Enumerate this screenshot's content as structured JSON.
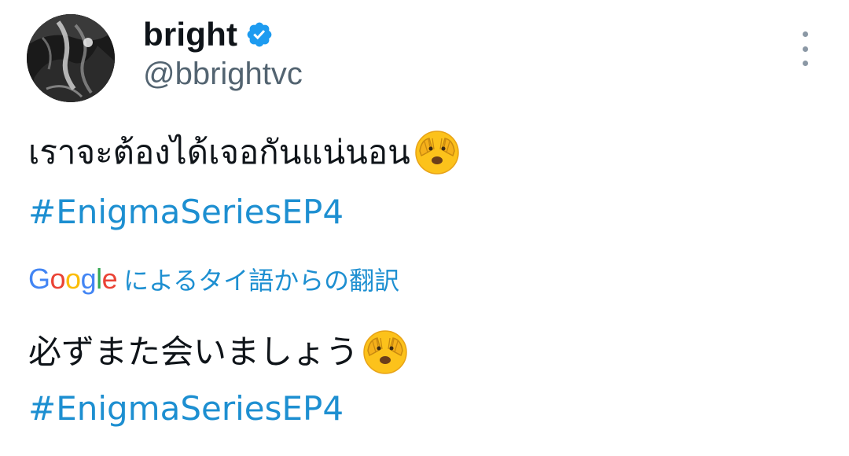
{
  "author": {
    "display_name": "bright",
    "handle": "@bbrightvc",
    "verified": true,
    "avatar_icon": "profile-photo"
  },
  "tweet": {
    "text": "เราจะต้องได้เจอกันแน่นอน",
    "emoji": "🫣",
    "hashtag": "#EnigmaSeriesEP4"
  },
  "translation": {
    "provider_letters": [
      "G",
      "o",
      "o",
      "g",
      "l",
      "e"
    ],
    "label": "によるタイ語からの翻訳",
    "text": "必ずまた会いましょう",
    "hashtag": "#EnigmaSeriesEP4"
  },
  "colors": {
    "link": "#1d8fd1",
    "verified": "#1d9bf0",
    "handle": "#536471",
    "text": "#0f1419"
  },
  "icons": {
    "verified": "verified-badge-icon",
    "more": "more-vertical-icon",
    "emoji": "face-peeking-emoji-icon"
  }
}
